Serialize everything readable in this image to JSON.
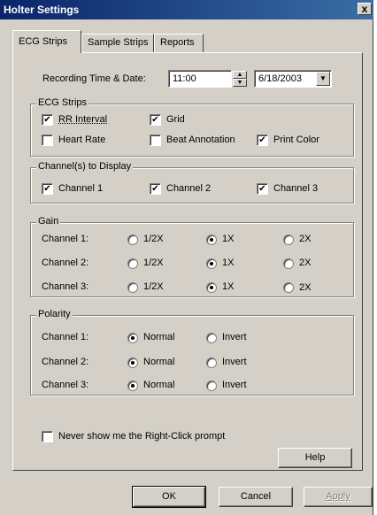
{
  "window": {
    "title": "Holter Settings",
    "close_glyph": "x"
  },
  "tabs": [
    {
      "label": "ECG Strips",
      "active": true
    },
    {
      "label": "Sample Strips",
      "active": false
    },
    {
      "label": "Reports",
      "active": false
    }
  ],
  "recording": {
    "label": "Recording Time & Date:",
    "time": "11:00",
    "date": "6/18/2003"
  },
  "ecg_strips": {
    "legend": "ECG Strips",
    "rr_interval": {
      "label": "RR Interval",
      "checked": true
    },
    "grid": {
      "label": "Grid",
      "checked": true
    },
    "heart_rate": {
      "label": "Heart Rate",
      "checked": false
    },
    "beat_annotation": {
      "label": "Beat Annotation",
      "checked": false
    },
    "print_color": {
      "label": "Print Color",
      "checked": true
    }
  },
  "channels_display": {
    "legend": "Channel(s) to Display",
    "ch1": {
      "label": "Channel 1",
      "checked": true
    },
    "ch2": {
      "label": "Channel 2",
      "checked": true
    },
    "ch3": {
      "label": "Channel 3",
      "checked": true
    }
  },
  "gain": {
    "legend": "Gain",
    "options": [
      "1/2X",
      "1X",
      "2X"
    ],
    "rows": [
      {
        "label": "Channel 1:",
        "selected": "1X"
      },
      {
        "label": "Channel 2:",
        "selected": "1X"
      },
      {
        "label": "Channel 3:",
        "selected": "1X"
      }
    ]
  },
  "polarity": {
    "legend": "Polarity",
    "options": [
      "Normal",
      "Invert"
    ],
    "rows": [
      {
        "label": "Channel 1:",
        "selected": "Normal"
      },
      {
        "label": "Channel 2:",
        "selected": "Normal"
      },
      {
        "label": "Channel 3:",
        "selected": "Normal"
      }
    ]
  },
  "never_show": {
    "label": "Never show me the Right-Click prompt",
    "checked": false
  },
  "buttons": {
    "help": "Help",
    "ok": "OK",
    "cancel": "Cancel",
    "apply": "Apply"
  },
  "glyphs": {
    "check": "✔",
    "spin_up": "▲",
    "spin_down": "▼",
    "dropdown": "▼"
  }
}
